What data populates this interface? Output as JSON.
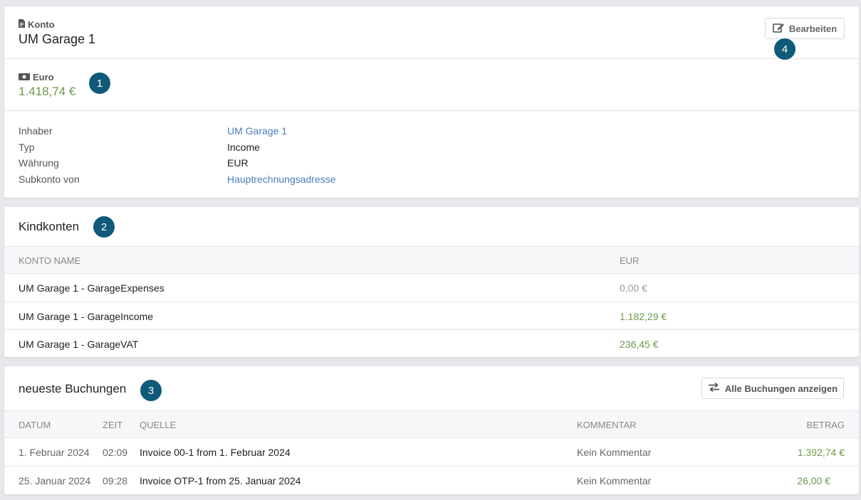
{
  "konto": {
    "label": "Konto",
    "title": "UM Garage 1",
    "edit_label": "Bearbeiten",
    "currency_label": "Euro",
    "balance": "1.418,74 €",
    "details": [
      {
        "label": "Inhaber",
        "value": "UM Garage 1"
      },
      {
        "label": "Typ",
        "value": "Income"
      },
      {
        "label": "Währung",
        "value": "EUR"
      },
      {
        "label": "Subkonto von",
        "value": "Hauptrechnungsadresse"
      }
    ]
  },
  "kindkonten": {
    "title": "Kindkonten",
    "headers": {
      "name": "KONTO NAME",
      "amount": "EUR"
    },
    "rows": [
      {
        "name": "UM Garage 1 - GarageExpenses",
        "amount": "0,00 €"
      },
      {
        "name": "UM Garage 1 - GarageIncome",
        "amount": "1.182,29 €"
      },
      {
        "name": "UM Garage 1 - GarageVAT",
        "amount": "236,45 €"
      }
    ]
  },
  "buchungen": {
    "title": "neueste Buchungen",
    "all_label": "Alle Buchungen anzeigen",
    "headers": {
      "datum": "DATUM",
      "zeit": "ZEIT",
      "quelle": "QUELLE",
      "kommentar": "KOMMENTAR",
      "betrag": "BETRAG"
    },
    "rows": [
      {
        "datum": "1. Februar 2024",
        "zeit": "02:09",
        "quelle": "Invoice 00-1 from 1. Februar 2024",
        "kommentar": "Kein Kommentar",
        "betrag": "1.392,74 €"
      },
      {
        "datum": "25. Januar 2024",
        "zeit": "09:28",
        "quelle": "Invoice OTP-1 from 25. Januar 2024",
        "kommentar": "Kein Kommentar",
        "betrag": "26,00 €"
      }
    ]
  },
  "badges": [
    "1",
    "2",
    "3",
    "4"
  ],
  "colors": {
    "accent_green": "#6c9a4a",
    "link_blue": "#4a7dbd",
    "badge_bg": "#0f5a78"
  }
}
